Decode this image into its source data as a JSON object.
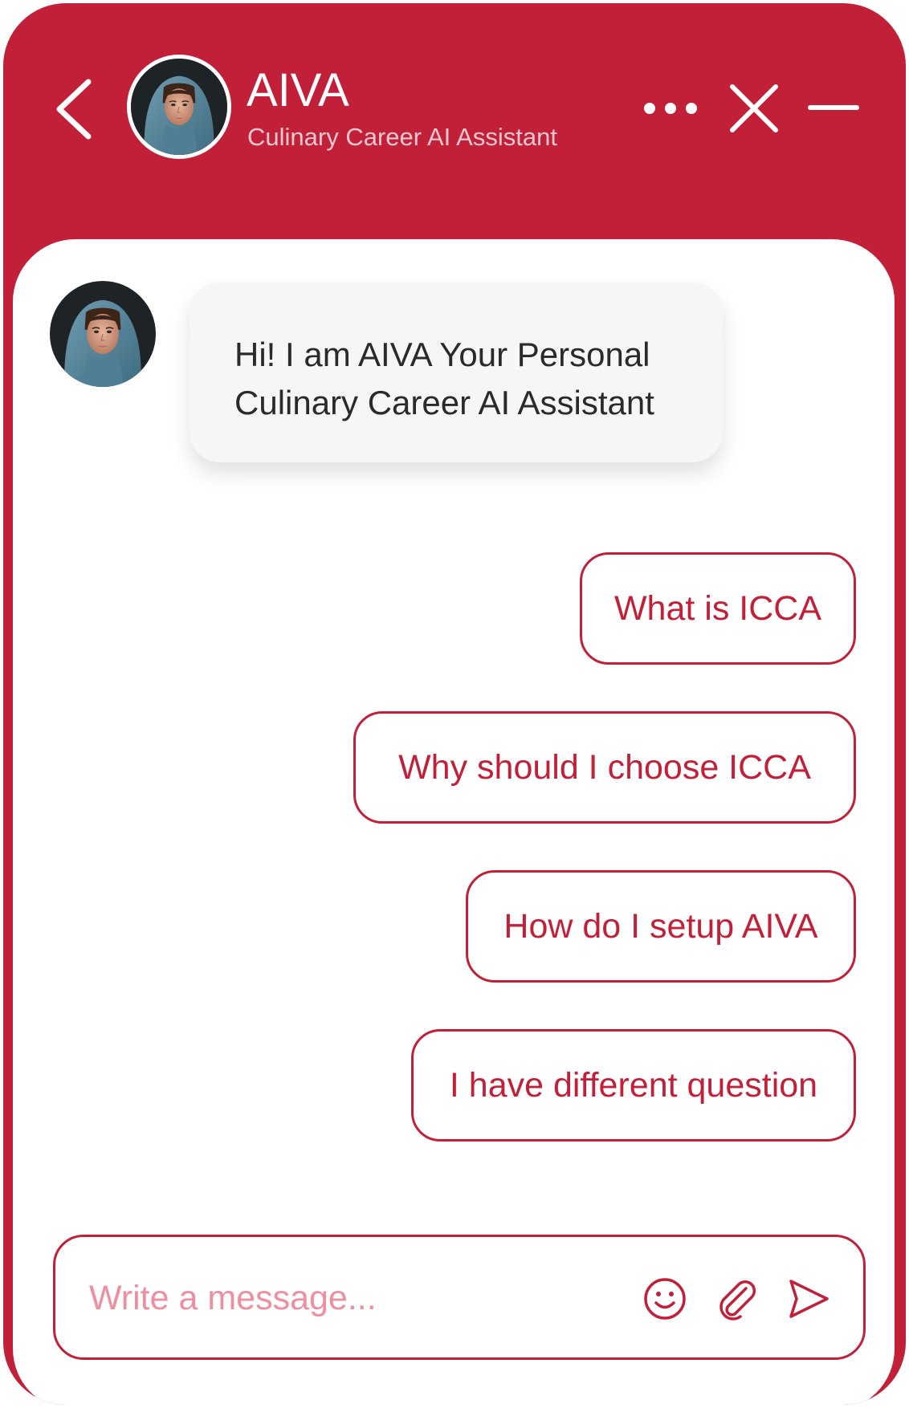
{
  "app": {
    "accent_color": "#c21f38",
    "background_color": "#ffffff"
  },
  "header": {
    "title": "AIVA",
    "subtitle": "Culinary Career AI Assistant",
    "icons": [
      "back-chevron-icon",
      "avatar-photo",
      "more-dots-icon",
      "close-icon",
      "minimize-icon"
    ]
  },
  "chat": {
    "greeting_line1": "Hi! I am AIVA Your Personal",
    "greeting_line2": "Culinary Career AI Assistant",
    "options": [
      {
        "label": "What is ICCA"
      },
      {
        "label": "Why should I choose ICCA"
      },
      {
        "label": "How do I setup AIVA"
      },
      {
        "label": "I have different question"
      }
    ]
  },
  "composer": {
    "placeholder": "Write a message...",
    "value": "",
    "icons": [
      "emoji-smile-icon",
      "paperclip-icon",
      "send-icon"
    ]
  }
}
